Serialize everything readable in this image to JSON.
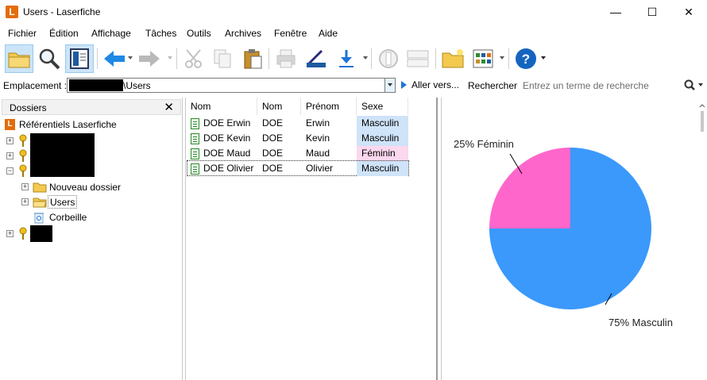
{
  "window": {
    "title": "Users - Laserfiche",
    "logo": "L",
    "minimize": "—",
    "maximize": "☐",
    "close": "✕"
  },
  "menu": [
    "Fichier",
    "Édition",
    "Affichage",
    "Tâches",
    "Outils",
    "Archives",
    "Fenêtre",
    "Aide"
  ],
  "address": {
    "label": "Emplacement :",
    "value": "\\Users",
    "go_label": "Aller vers...",
    "search_label": "Rechercher :",
    "search_placeholder": "Entrez un terme de recherche"
  },
  "folders_pane": {
    "title": "Dossiers",
    "close": "✕",
    "root": "Référentiels Laserfiche",
    "children": [
      "Nouveau dossier",
      "Users",
      "Corbeille"
    ]
  },
  "table": {
    "headers": [
      "Nom",
      "Nom",
      "Prénom",
      "Sexe"
    ],
    "rows": [
      {
        "name": "DOE Erwin",
        "last": "DOE",
        "first": "Erwin",
        "sexe": "Masculin"
      },
      {
        "name": "DOE Kevin",
        "last": "DOE",
        "first": "Kevin",
        "sexe": "Masculin"
      },
      {
        "name": "DOE Maud",
        "last": "DOE",
        "first": "Maud",
        "sexe": "Féminin"
      },
      {
        "name": "DOE Olivier",
        "last": "DOE",
        "first": "Olivier",
        "sexe": "Masculin"
      }
    ]
  },
  "colors": {
    "masculin": "#3a99fb",
    "feminin": "#fe66cb",
    "masculin_cell": "#cfe3f9",
    "feminin_cell": "#fbd8ee"
  },
  "chart_data": {
    "type": "pie",
    "slices": [
      {
        "label": "Masculin",
        "value": 75,
        "text": "75% Masculin",
        "color": "#3a99fb"
      },
      {
        "label": "Féminin",
        "value": 25,
        "text": "25% Féminin",
        "color": "#fe66cb"
      }
    ]
  }
}
